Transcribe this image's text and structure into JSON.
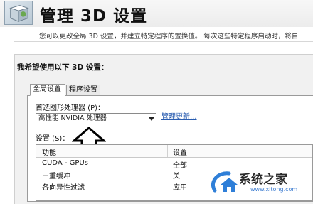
{
  "window": {
    "title": "管理 3D 设置",
    "description": "您可以更改全局 3D 设置，并建立特定程序的置换值。 每次这些特定程序启动时，将自"
  },
  "settings": {
    "heading": "我希望使用以下 3D 设置：",
    "tabs": [
      {
        "label": "全局设置",
        "active": true
      },
      {
        "label": "程序设置",
        "active": false
      }
    ],
    "gpu_label": "首选图形处理器 (P)：",
    "gpu_selected": "高性能 NVIDIA 处理器",
    "manage_link": "管理更新...",
    "settings_label": "设置 (S)：",
    "table": {
      "columns": [
        "功能",
        "设置"
      ],
      "rows": [
        [
          "CUDA - GPUs",
          "全部"
        ],
        [
          "三重缓冲",
          "关"
        ],
        [
          "各向异性过滤",
          "应用"
        ]
      ]
    }
  },
  "watermark": {
    "text": "系统之家",
    "url": "www.xitong.com"
  },
  "colors": {
    "link": "#2a5db0",
    "panel_bg": "#f1f1f1",
    "watermark_blue": "#2f7fd8"
  },
  "icons": {
    "logo": "nvidia-3d-cube-icon",
    "pointer": "up-arrow-icon",
    "dropdown": "chevron-down-icon"
  }
}
